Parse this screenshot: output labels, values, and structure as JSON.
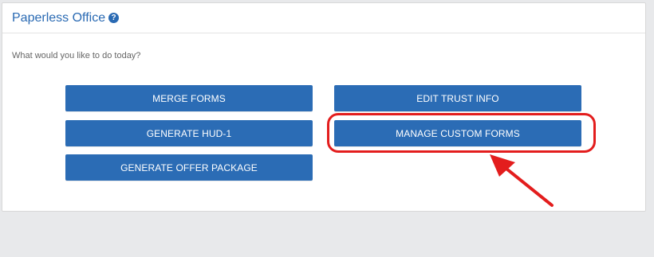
{
  "panel": {
    "title": "Paperless Office",
    "help_icon": "question-circle-icon",
    "prompt": "What would you like to do today?"
  },
  "actions": {
    "merge_forms": "MERGE FORMS",
    "generate_hud1": "GENERATE HUD-1",
    "generate_offer_package": "GENERATE OFFER PACKAGE",
    "edit_trust_info": "EDIT TRUST INFO",
    "manage_custom_forms": "MANAGE CUSTOM FORMS"
  },
  "colors": {
    "accent": "#2b6cb5",
    "annotation": "#e31d1d"
  }
}
